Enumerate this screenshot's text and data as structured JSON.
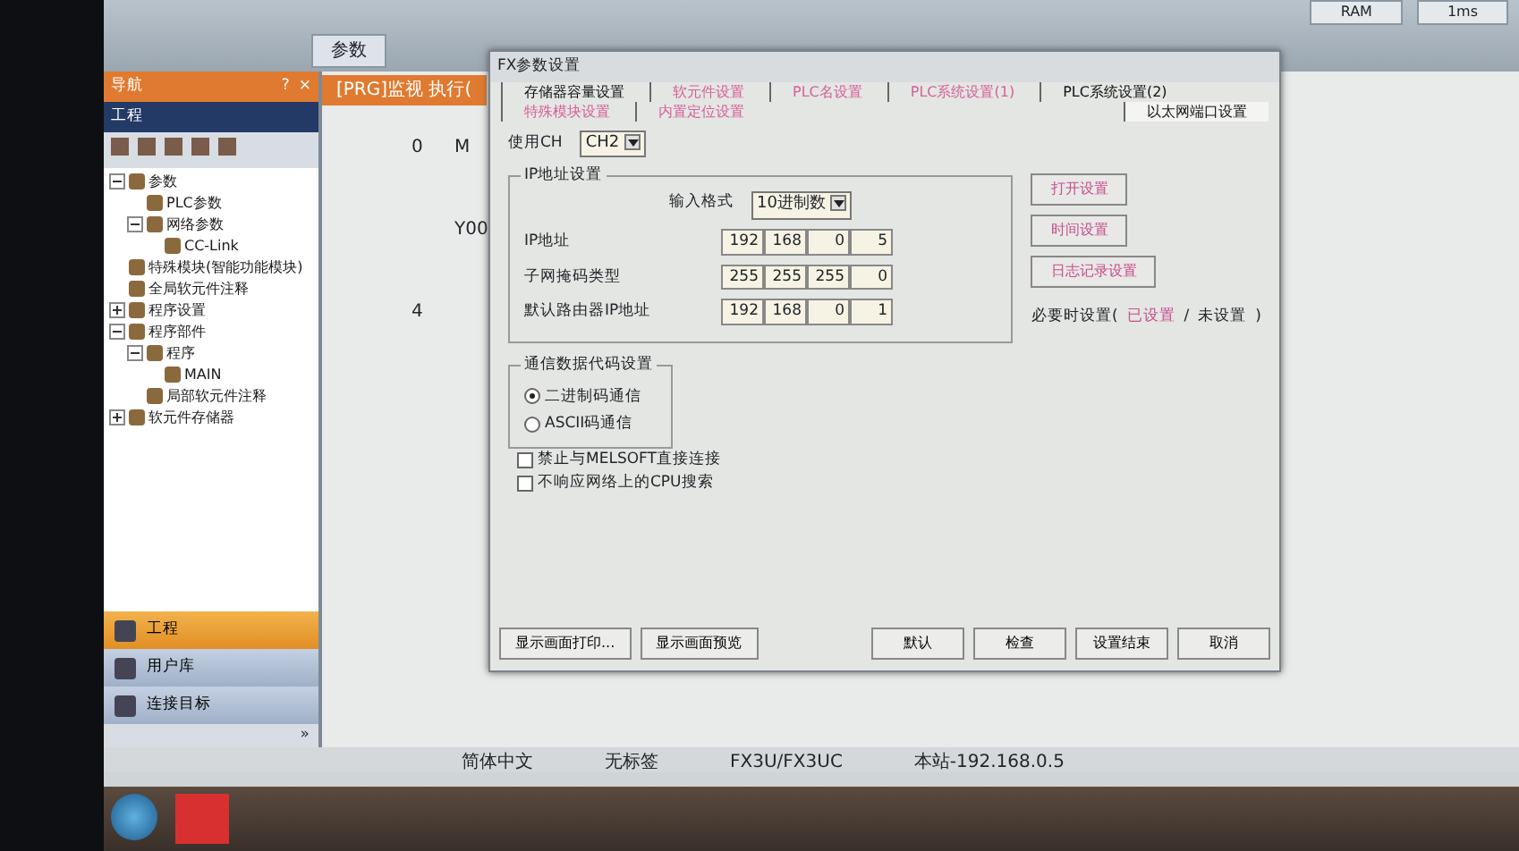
{
  "toolbar": {
    "tab": "参数",
    "status_1": "RAM",
    "status_2": "1ms"
  },
  "navigator": {
    "title": "导航",
    "help": "?",
    "close": "×",
    "section": "工程",
    "tree": [
      {
        "label": "参数",
        "expanded": true,
        "children": [
          {
            "label": "PLC参数"
          },
          {
            "label": "网络参数",
            "expanded": true,
            "children": [
              {
                "label": "CC-Link"
              }
            ]
          }
        ]
      },
      {
        "label": "特殊模块(智能功能模块)"
      },
      {
        "label": "全局软元件注释"
      },
      {
        "label": "程序设置",
        "expanded": false
      },
      {
        "label": "程序部件",
        "expanded": true,
        "children": [
          {
            "label": "程序",
            "expanded": true,
            "children": [
              {
                "label": "MAIN"
              }
            ]
          },
          {
            "label": "局部软元件注释"
          }
        ]
      },
      {
        "label": "软元件存储器",
        "expanded": false
      }
    ],
    "views": [
      {
        "label": "工程",
        "selected": true
      },
      {
        "label": "用户库",
        "selected": false
      },
      {
        "label": "连接目标",
        "selected": false
      }
    ],
    "more": "»"
  },
  "editor": {
    "tab": "[PRG]监视 执行(",
    "rungs": [
      {
        "step": "0",
        "device": "M"
      },
      {
        "device": "Y00"
      },
      {
        "step": "4"
      }
    ]
  },
  "dialog": {
    "title": "FX参数设置",
    "tabs_row_1": [
      {
        "label": "存储器容量设置",
        "modified": false,
        "selected": false
      },
      {
        "label": "软元件设置",
        "modified": true,
        "selected": false
      },
      {
        "label": "PLC名设置",
        "modified": true,
        "selected": false
      },
      {
        "label": "PLC系统设置(1)",
        "modified": true,
        "selected": false
      },
      {
        "label": "PLC系统设置(2)",
        "modified": false,
        "selected": false
      }
    ],
    "tabs_row_2": [
      {
        "label": "特殊模块设置",
        "modified": true,
        "selected": false
      },
      {
        "label": "内置定位设置",
        "modified": true,
        "selected": false
      },
      {
        "label": "以太网端口设置",
        "modified": false,
        "selected": true
      }
    ],
    "channel": {
      "label": "使用CH",
      "value": "CH2"
    },
    "ip_group": {
      "title": "IP地址设置",
      "format_label": "输入格式",
      "format_value": "10进制数",
      "rows": [
        {
          "label": "IP地址",
          "octets": [
            "192",
            "168",
            "0",
            "5"
          ]
        },
        {
          "label": "子网掩码类型",
          "octets": [
            "255",
            "255",
            "255",
            "0"
          ]
        },
        {
          "label": "默认路由器IP地址",
          "octets": [
            "192",
            "168",
            "0",
            "1"
          ]
        }
      ]
    },
    "side_buttons": [
      "打开设置",
      "时间设置",
      "日志记录设置"
    ],
    "note": {
      "prefix": "必要时设置(",
      "set": "已设置",
      "slash": "/",
      "unset": "未设置",
      "suffix": ")"
    },
    "code_group": {
      "title": "通信数据代码设置",
      "options": [
        {
          "label": "二进制码通信",
          "selected": true
        },
        {
          "label": "ASCII码通信",
          "selected": false
        }
      ]
    },
    "checkboxes": [
      {
        "label": "禁止与MELSOFT直接连接",
        "checked": false
      },
      {
        "label": "不响应网络上的CPU搜索",
        "checked": false
      }
    ],
    "left_buttons": [
      "显示画面打印...",
      "显示画面预览"
    ],
    "right_buttons": [
      "默认",
      "检查",
      "设置结束",
      "取消"
    ]
  },
  "status_bar": [
    "简体中文",
    "无标签",
    "FX3U/FX3UC",
    "本站-192.168.0.5"
  ]
}
